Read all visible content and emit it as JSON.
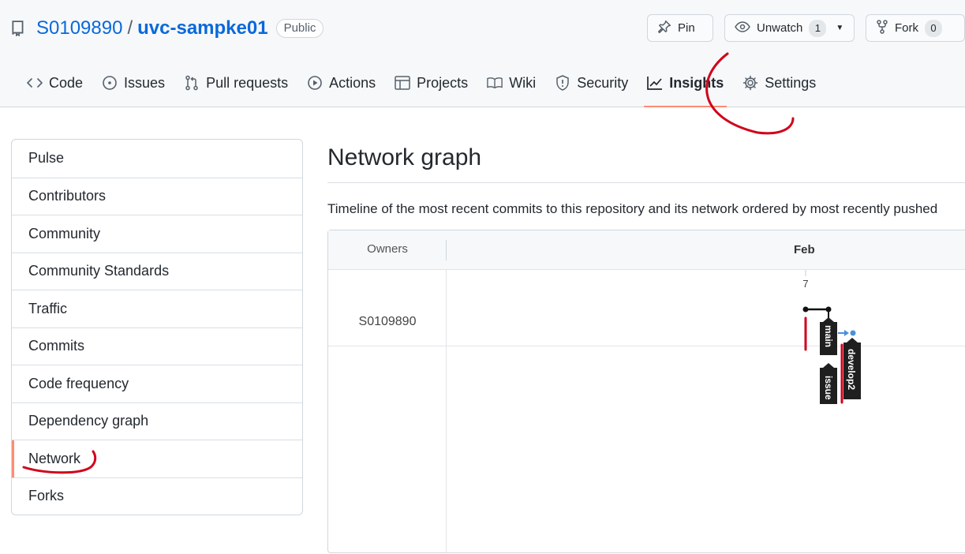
{
  "repo": {
    "owner": "S0109890",
    "separator": "/",
    "name": "uvc-sampke01",
    "visibility": "Public"
  },
  "actions": {
    "pin_label": "Pin",
    "unwatch_label": "Unwatch",
    "unwatch_count": "1",
    "fork_label": "Fork",
    "fork_count": "0"
  },
  "nav": {
    "tabs": [
      {
        "label": "Code",
        "icon": "code-icon"
      },
      {
        "label": "Issues",
        "icon": "issue-icon"
      },
      {
        "label": "Pull requests",
        "icon": "pull-request-icon"
      },
      {
        "label": "Actions",
        "icon": "play-icon"
      },
      {
        "label": "Projects",
        "icon": "table-icon"
      },
      {
        "label": "Wiki",
        "icon": "book-icon"
      },
      {
        "label": "Security",
        "icon": "shield-icon"
      },
      {
        "label": "Insights",
        "icon": "graph-icon",
        "selected": true
      },
      {
        "label": "Settings",
        "icon": "gear-icon"
      }
    ]
  },
  "sidebar": {
    "items": [
      {
        "label": "Pulse"
      },
      {
        "label": "Contributors"
      },
      {
        "label": "Community"
      },
      {
        "label": "Community Standards"
      },
      {
        "label": "Traffic"
      },
      {
        "label": "Commits"
      },
      {
        "label": "Code frequency"
      },
      {
        "label": "Dependency graph"
      },
      {
        "label": "Network",
        "selected": true
      },
      {
        "label": "Forks"
      }
    ]
  },
  "main": {
    "title": "Network graph",
    "description": "Timeline of the most recent commits to this repository and its network ordered by most recently pushed"
  },
  "graph": {
    "owners_header": "Owners",
    "month": "Feb",
    "day": "7",
    "owner": "S0109890",
    "branches": [
      "main",
      "develop2",
      "issue"
    ]
  },
  "colors": {
    "accent_link": "#0969da",
    "selected_underline": "#fd8c73",
    "annotation_red": "#d0021b",
    "branch_blue": "#4a90d9"
  }
}
